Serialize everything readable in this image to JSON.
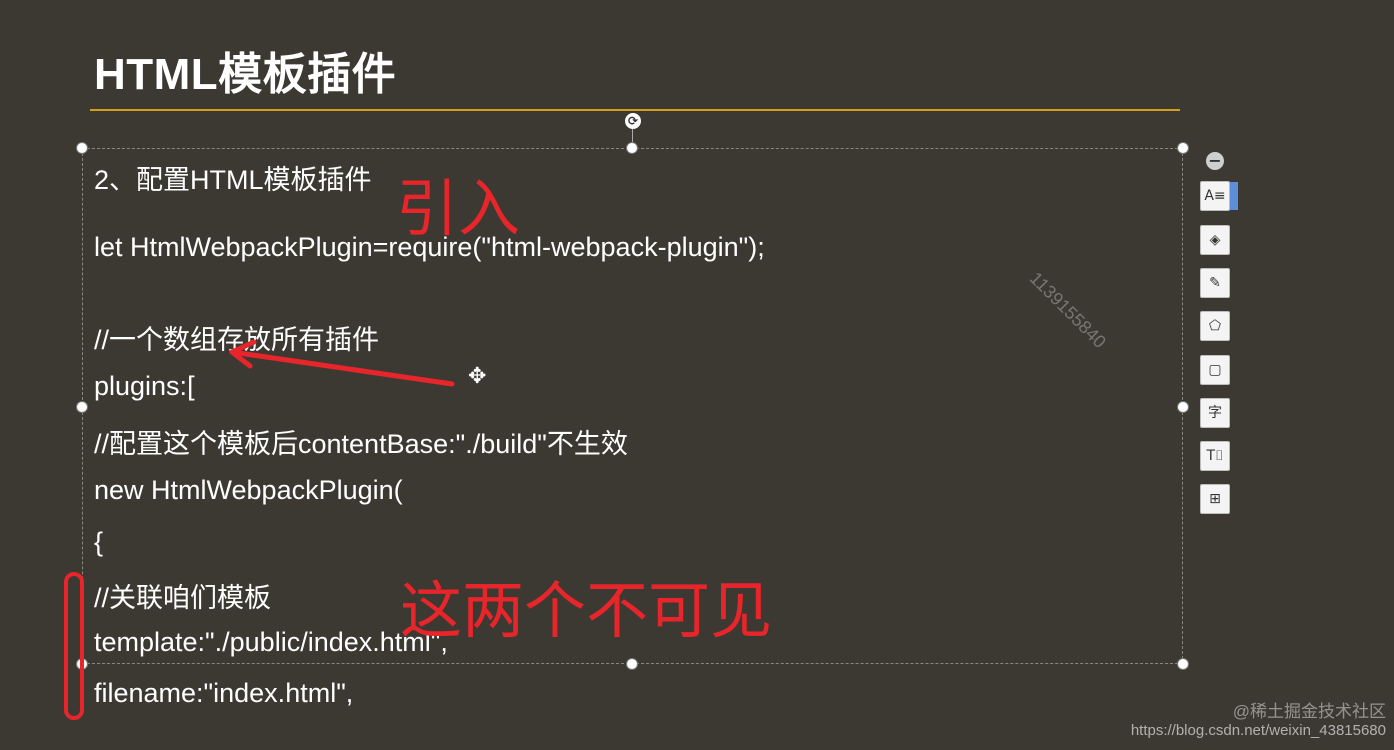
{
  "slide": {
    "title": "HTML模板插件"
  },
  "code_lines": [
    "2、配置HTML模板插件",
    "let HtmlWebpackPlugin=require(\"html-webpack-plugin\");",
    "//一个数组存放所有插件",
    "plugins:[",
    "//配置这个模板后contentBase:\"./build\"不生效",
    "new HtmlWebpackPlugin(",
    "{",
    "//关联咱们模板",
    "template:\"./public/index.html\",",
    "filename:\"index.html\","
  ],
  "annotations": {
    "import_note": "引入",
    "invisible_note": "这两个不可见",
    "color": "#e8252a"
  },
  "watermark": {
    "text": "1139155840"
  },
  "toolbar": {
    "collapse_icon": "minus-circle-icon",
    "tools": [
      {
        "icon": "text-style-icon",
        "glyph": "A≡"
      },
      {
        "icon": "layers-icon",
        "glyph": "◈"
      },
      {
        "icon": "brush-icon",
        "glyph": "✎"
      },
      {
        "icon": "fill-shape-icon",
        "glyph": "⬠"
      },
      {
        "icon": "border-icon",
        "glyph": "▢"
      },
      {
        "icon": "font-icon",
        "glyph": "字"
      },
      {
        "icon": "text-box-icon",
        "glyph": "T⌷"
      },
      {
        "icon": "more-tools-icon",
        "glyph": "⊞"
      }
    ]
  },
  "credit": {
    "site_name": "@稀土掘金技术社区",
    "url": "https://blog.csdn.net/weixin_43815680"
  },
  "colors": {
    "background": "#3c3933",
    "title_rule": "#d4a017",
    "text": "#ffffff"
  }
}
